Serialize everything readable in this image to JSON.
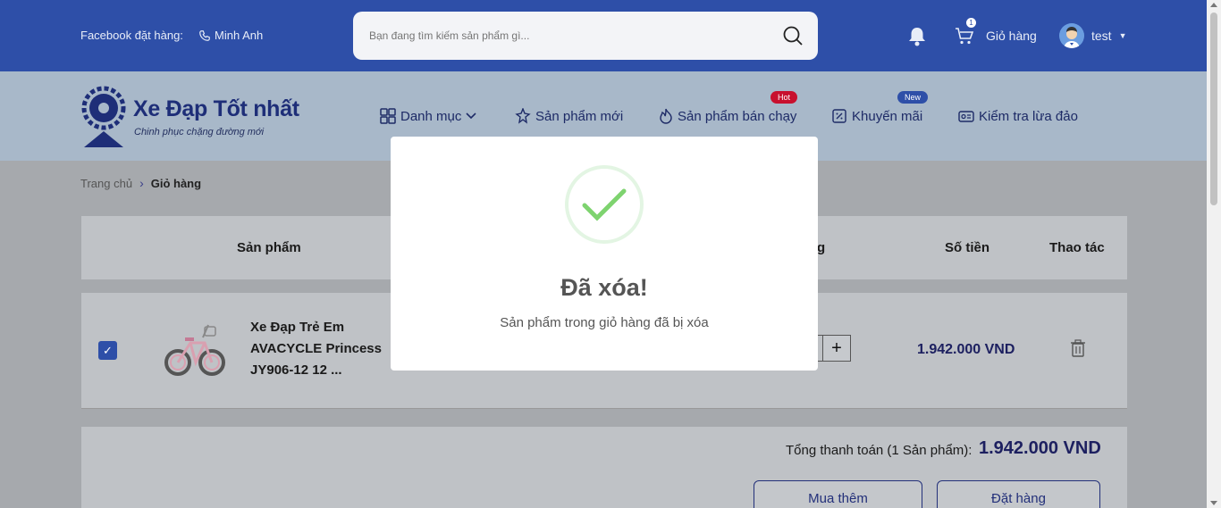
{
  "header": {
    "facebook_label": "Facebook đặt hàng:",
    "contact_name": "Minh Anh",
    "search_placeholder": "Bạn đang tìm kiếm sản phẩm gì...",
    "cart_label": "Giỏ hàng",
    "cart_count": "1",
    "user_name": "test"
  },
  "brand": {
    "name": "Xe Đạp Tốt nhất",
    "slogan": "Chinh phục chặng đường mới"
  },
  "nav": {
    "items": [
      {
        "label": "Danh mục",
        "icon": "grid-icon"
      },
      {
        "label": "Sản phẩm mới",
        "icon": "sparkle-icon"
      },
      {
        "label": "Sản phẩm bán chạy",
        "icon": "fire-icon",
        "badge": "Hot"
      },
      {
        "label": "Khuyến mãi",
        "icon": "ticket-icon",
        "badge": "New"
      },
      {
        "label": "Kiểm tra lừa đảo",
        "icon": "id-card-icon"
      }
    ]
  },
  "breadcrumb": {
    "home": "Trang chủ",
    "separator": "›",
    "current": "Giỏ hàng"
  },
  "cart_table": {
    "columns": {
      "product": "Sản phẩm",
      "quantity_partial": "g",
      "amount": "Số tiền",
      "actions": "Thao tác"
    },
    "rows": [
      {
        "checked": true,
        "name": "Xe Đạp Trẻ Em AVACYCLE Princess JY906-12 12 ...",
        "qty_plus": "+",
        "price": "1.942.000 VND"
      }
    ]
  },
  "summary": {
    "total_label": "Tổng thanh toán (1 Sản phẩm):",
    "total_value": "1.942.000 VND",
    "buy_more_label": "Mua thêm",
    "order_label": "Đặt hàng"
  },
  "modal": {
    "title": "Đã xóa!",
    "message": "Sản phẩm trong giỏ hàng đã bị xóa"
  },
  "colors": {
    "header_bg": "#2e4fa8",
    "brand_dark": "#1e2e78",
    "hot_badge": "#c8102e",
    "new_badge": "#2e4fa8",
    "success_green": "#7ed36f"
  }
}
